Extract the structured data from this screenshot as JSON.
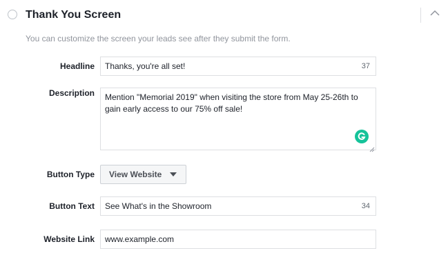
{
  "section": {
    "title": "Thank You Screen",
    "subtitle": "You can customize the screen your leads see after they submit the form."
  },
  "form": {
    "headline": {
      "label": "Headline",
      "value": "Thanks, you're all set!",
      "char_count": "37"
    },
    "description": {
      "label": "Description",
      "value": "Mention \"Memorial 2019\" when visiting the store from May 25-26th to gain early access to our 75% off sale!"
    },
    "button_type": {
      "label": "Button Type",
      "selected": "View Website"
    },
    "button_text": {
      "label": "Button Text",
      "value": "See What's in the Showroom",
      "char_count": "34"
    },
    "website_link": {
      "label": "Website Link",
      "value": "www.example.com"
    }
  },
  "icons": {
    "collapse": "chevron-up-icon",
    "grammarly": "grammarly-icon",
    "dropdown": "caret-down-icon"
  },
  "colors": {
    "grammarly": "#15c39a",
    "border": "#dddfe2",
    "muted_text": "#90949c"
  }
}
